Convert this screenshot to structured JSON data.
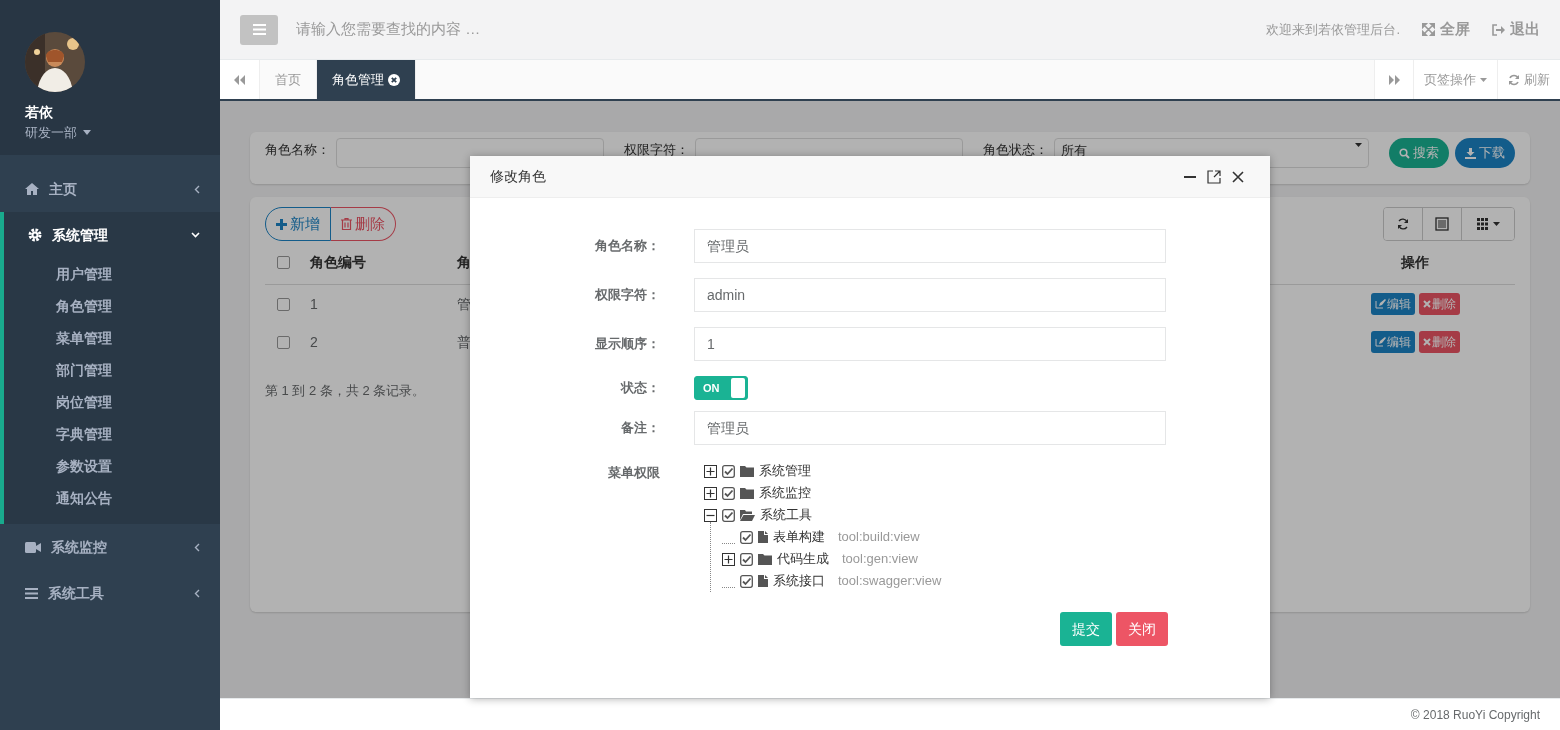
{
  "sidebar": {
    "user": {
      "name": "若依",
      "dept": "研发一部"
    },
    "items": [
      {
        "label": "主页",
        "expanded": false
      },
      {
        "label": "系统管理",
        "expanded": true,
        "children": [
          "用户管理",
          "角色管理",
          "菜单管理",
          "部门管理",
          "岗位管理",
          "字典管理",
          "参数设置",
          "通知公告"
        ]
      },
      {
        "label": "系统监控",
        "expanded": false
      },
      {
        "label": "系统工具",
        "expanded": false
      }
    ]
  },
  "header": {
    "search_placeholder": "请输入您需要查找的内容 …",
    "welcome": "欢迎来到若依管理后台.",
    "fullscreen": "全屏",
    "logout": "退出"
  },
  "tabs": [
    {
      "label": "首页",
      "selected": false
    },
    {
      "label": "角色管理",
      "selected": true
    }
  ],
  "tab_tools": {
    "page_ops": "页签操作",
    "refresh": "刷新"
  },
  "filter": {
    "fields": [
      {
        "label": "角色名称：",
        "kind": "input"
      },
      {
        "label": "权限字符：",
        "kind": "input"
      },
      {
        "label": "角色状态：",
        "kind": "select",
        "value": "所有"
      }
    ],
    "search": "搜索",
    "download": "下载"
  },
  "toolbar": {
    "add": "新增",
    "delete": "删除"
  },
  "table": {
    "all_checked": false,
    "columns": [
      "角色编号",
      "角",
      "操作"
    ],
    "rows": [
      {
        "checked": false,
        "cells": [
          "1",
          "管"
        ],
        "actions": [
          "编辑",
          "删除"
        ]
      },
      {
        "checked": false,
        "cells": [
          "2",
          "普"
        ],
        "actions": [
          "编辑",
          "删除"
        ]
      }
    ],
    "summary": "第 1 到 2 条，共 2 条记录。"
  },
  "modal": {
    "title": "修改角色",
    "fields": [
      {
        "label": "角色名称：",
        "value": "管理员"
      },
      {
        "label": "权限字符：",
        "value": "admin"
      },
      {
        "label": "显示顺序：",
        "value": "1"
      }
    ],
    "status": {
      "label": "状态：",
      "on": true,
      "text": "ON"
    },
    "remark": {
      "label": "备注：",
      "value": "管理员"
    },
    "menu_label": "菜单权限",
    "tree": [
      {
        "label": "系统管理",
        "kind": "folder",
        "checked": true,
        "expanded": false
      },
      {
        "label": "系统监控",
        "kind": "folder",
        "checked": true,
        "expanded": false
      },
      {
        "label": "系统工具",
        "kind": "folder",
        "checked": true,
        "expanded": true,
        "children": [
          {
            "label": "表单构建",
            "kind": "page",
            "checked": true,
            "perm": "tool:build:view"
          },
          {
            "label": "代码生成",
            "kind": "folder",
            "checked": true,
            "expanded": false,
            "perm": "tool:gen:view"
          },
          {
            "label": "系统接口",
            "kind": "page",
            "checked": true,
            "perm": "tool:swagger:view"
          }
        ]
      }
    ],
    "buttons": [
      {
        "label": "提交",
        "kind": "primary"
      },
      {
        "label": "关闭",
        "kind": "danger"
      }
    ]
  },
  "footer": "© 2018 RuoYi Copyright"
}
